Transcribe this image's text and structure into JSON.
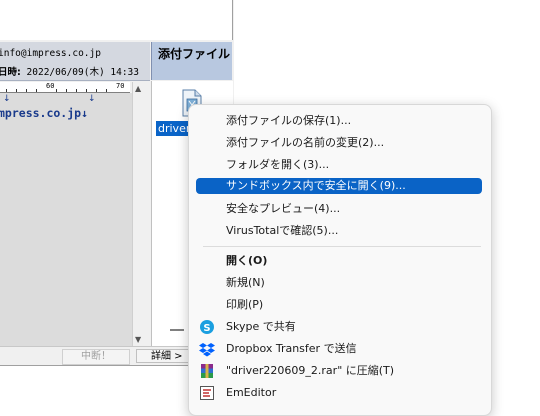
{
  "mail": {
    "header_from": "info@impress.co.jp",
    "date_label": "日時:",
    "date_value": "2022/06/09(木) 14:33",
    "ruler_60": "60",
    "ruler_70": "70",
    "body_arrow": "↓",
    "body_line": "mpress.co.jp↓"
  },
  "attachments": {
    "header": "添付ファイル",
    "file_label": "driver"
  },
  "statusbar": {
    "interrupt_label": "中断！",
    "detail_label": "詳細 >"
  },
  "context_menu": {
    "items": [
      {
        "label": "添付ファイルの保存(1)..."
      },
      {
        "label": "添付ファイルの名前の変更(2)..."
      },
      {
        "label": "フォルダを開く(3)..."
      },
      {
        "label": "サンドボックス内で安全に開く(9)..."
      },
      {
        "label": "安全なプレビュー(4)..."
      },
      {
        "label": "VirusTotalで確認(5)..."
      },
      {
        "label": "開く(O)"
      },
      {
        "label": "新規(N)"
      },
      {
        "label": "印刷(P)"
      },
      {
        "label": "Skype で共有",
        "icon": "skype-icon"
      },
      {
        "label": "Dropbox Transfer で送信",
        "icon": "dropbox-icon"
      },
      {
        "label": "\"driver220609_2.rar\" に圧縮(T)",
        "icon": "winrar-icon"
      },
      {
        "label": "EmEditor",
        "icon": "emeditor-icon"
      }
    ]
  },
  "colors": {
    "highlight": "#0a63c6",
    "attach_header": "#b8c8e0"
  }
}
